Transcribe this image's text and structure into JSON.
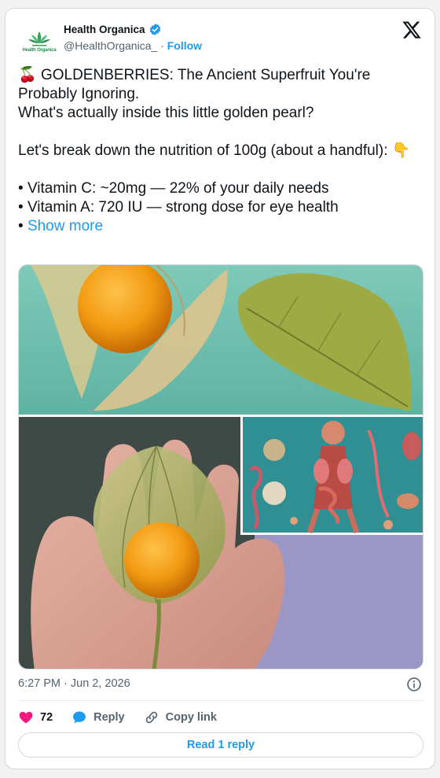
{
  "author": {
    "name": "Health Organica",
    "handle": "@HealthOrganica_",
    "separator": "·",
    "follow_label": "Follow",
    "avatar_text": "Health Organica",
    "verified_icon": "verified-badge-icon"
  },
  "tweet": {
    "line1_emoji": "🍒",
    "line1": "GOLDENBERRIES: The Ancient Superfruit You're Probably Ignoring.",
    "line2": "What's actually inside this little golden pearl?",
    "line3": "Let's break down the nutrition of 100g (about a handful):",
    "line3_emoji": "👇",
    "bullet": "•",
    "bullet1": "Vitamin C: ~20mg — 22% of your daily needs",
    "bullet2": "Vitamin A: 720 IU — strong dose for eye health",
    "show_more": "Show more"
  },
  "media": {
    "description_icons": [
      "goldenberry-photo",
      "anatomy-illustration",
      "hand-holding-berry-photo"
    ]
  },
  "meta": {
    "timestamp": "6:27 PM · Jun 2, 2026"
  },
  "actions": {
    "like_count": "72",
    "reply_label": "Reply",
    "copy_label": "Copy link",
    "read_reply_label": "Read 1 reply"
  },
  "colors": {
    "accent": "#1d9bf0",
    "like": "#f91880",
    "text": "#0f1419",
    "muted": "#536471"
  }
}
